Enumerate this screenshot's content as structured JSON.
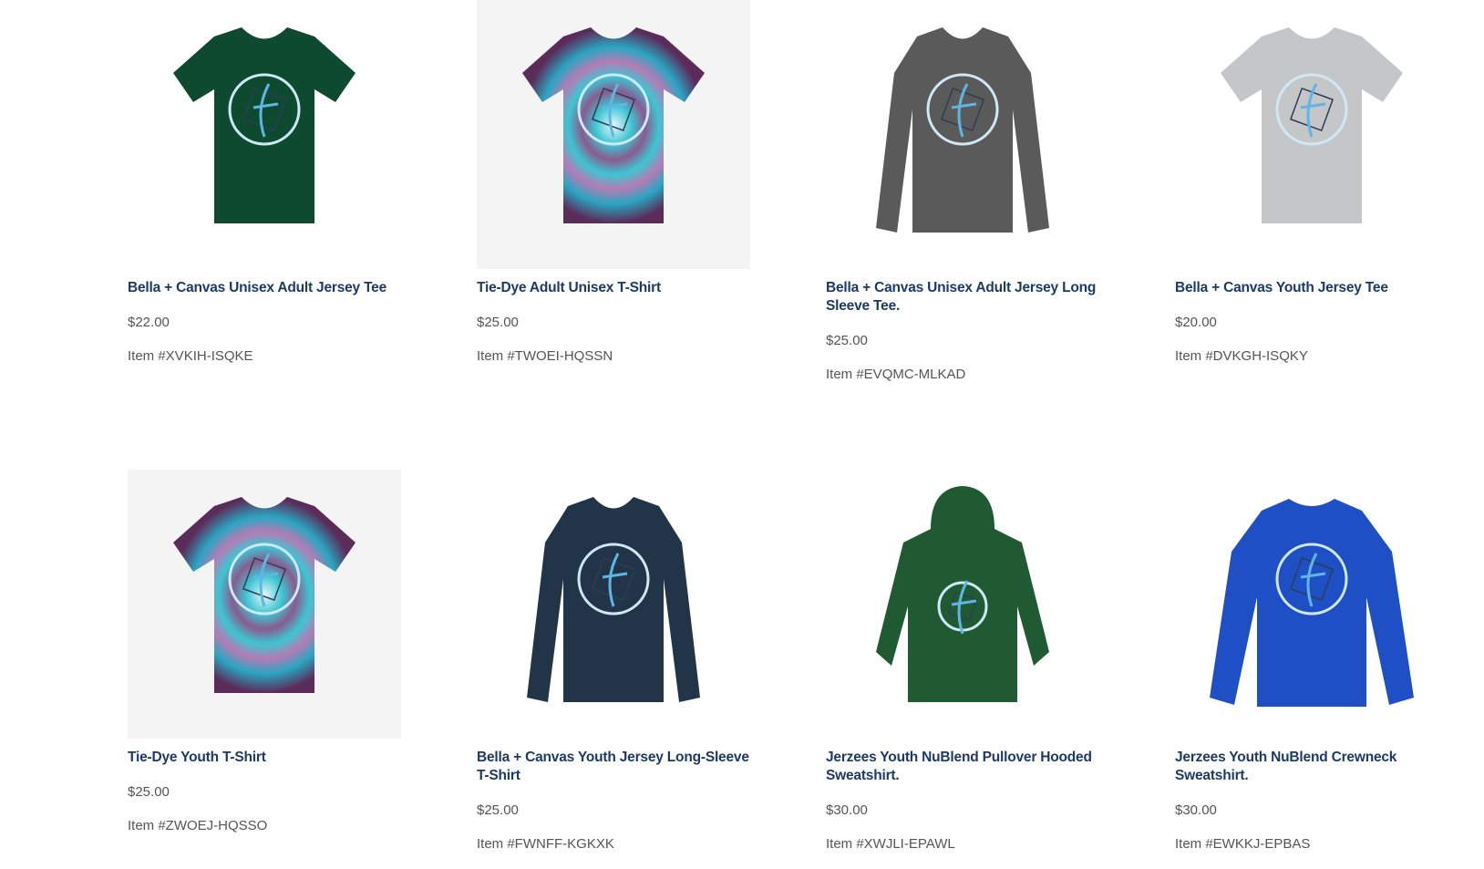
{
  "products": [
    {
      "name": "Bella + Canvas Unisex Adult Jersey Tee",
      "price": "$22.00",
      "item": "Item #XVKIH-ISQKE",
      "shape": "tee",
      "color": "#0e4a2f",
      "style": "solid"
    },
    {
      "name": "Tie-Dye Adult Unisex T-Shirt",
      "price": "$25.00",
      "item": "Item #TWOEI-HQSSN",
      "shape": "tee",
      "color": "#3cc6d2",
      "style": "tiedye"
    },
    {
      "name": "Bella + Canvas Unisex Adult Jersey Long Sleeve Tee.",
      "price": "$25.00",
      "item": "Item #EVQMC-MLKAD",
      "shape": "long",
      "color": "#5a5a5a",
      "style": "solid"
    },
    {
      "name": "Bella + Canvas Youth Jersey Tee",
      "price": "$20.00",
      "item": "Item #DVKGH-ISQKY",
      "shape": "tee",
      "color": "#c4c6c8",
      "style": "solid"
    },
    {
      "name": "Tie-Dye Youth T-Shirt",
      "price": "$25.00",
      "item": "Item #ZWOEJ-HQSSO",
      "shape": "tee",
      "color": "#3cc6d2",
      "style": "tiedye"
    },
    {
      "name": "Bella + Canvas Youth Jersey Long-Sleeve T-Shirt",
      "price": "$25.00",
      "item": "Item #FWNFF-KGKXK",
      "shape": "long",
      "color": "#223447",
      "style": "solid"
    },
    {
      "name": "Jerzees Youth NuBlend Pullover Hooded Sweatshirt.",
      "price": "$30.00",
      "item": "Item #XWJLI-EPAWL",
      "shape": "hood",
      "color": "#1f5a33",
      "style": "solid"
    },
    {
      "name": "Jerzees Youth NuBlend Crewneck Sweatshirt.",
      "price": "$30.00",
      "item": "Item #EWKKJ-EPBAS",
      "shape": "crew",
      "color": "#1f4fc4",
      "style": "solid"
    }
  ]
}
